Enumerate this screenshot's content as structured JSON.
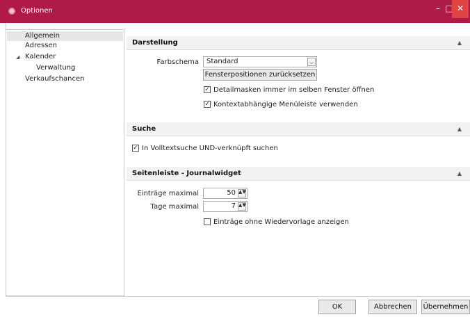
{
  "window": {
    "title": "Optionen",
    "minimize": "–",
    "maximize": "□",
    "close": "✕"
  },
  "nav": {
    "items": [
      {
        "label": "Allgemein"
      },
      {
        "label": "Adressen"
      },
      {
        "label": "Kalender"
      },
      {
        "label": "Verwaltung"
      },
      {
        "label": "Verkaufschancen"
      }
    ]
  },
  "sections": {
    "darstellung": {
      "title": "Darstellung",
      "farbschema_label": "Farbschema",
      "farbschema_value": "Standard",
      "reset_button": "Fensterpositionen zurücksetzen",
      "check1": {
        "label": "Detailmasken immer im selben Fenster öffnen",
        "checked": true
      },
      "check2": {
        "label": "Kontextabhängige Menüleiste verwenden",
        "checked": true
      }
    },
    "suche": {
      "title": "Suche",
      "check1": {
        "label": "In Volltextsuche UND-verknüpft suchen",
        "checked": true
      }
    },
    "seitenleiste": {
      "title": "Seitenleiste - Journalwidget",
      "eintraege_label": "Einträge maximal",
      "eintraege_value": "50",
      "tage_label": "Tage maximal",
      "tage_value": "7",
      "check1": {
        "label": "Einträge ohne Wiedervorlage anzeigen",
        "checked": false
      }
    }
  },
  "footer": {
    "ok": "OK",
    "cancel": "Abbrechen",
    "apply": "Übernehmen"
  },
  "glyphs": {
    "check": "✓",
    "collapse": "▲",
    "expand_arrow": "◢",
    "dropdown": "⌵",
    "spin": "▲▼"
  },
  "colors": {
    "titlebar": "#b01a47",
    "close_button": "#e04343"
  }
}
